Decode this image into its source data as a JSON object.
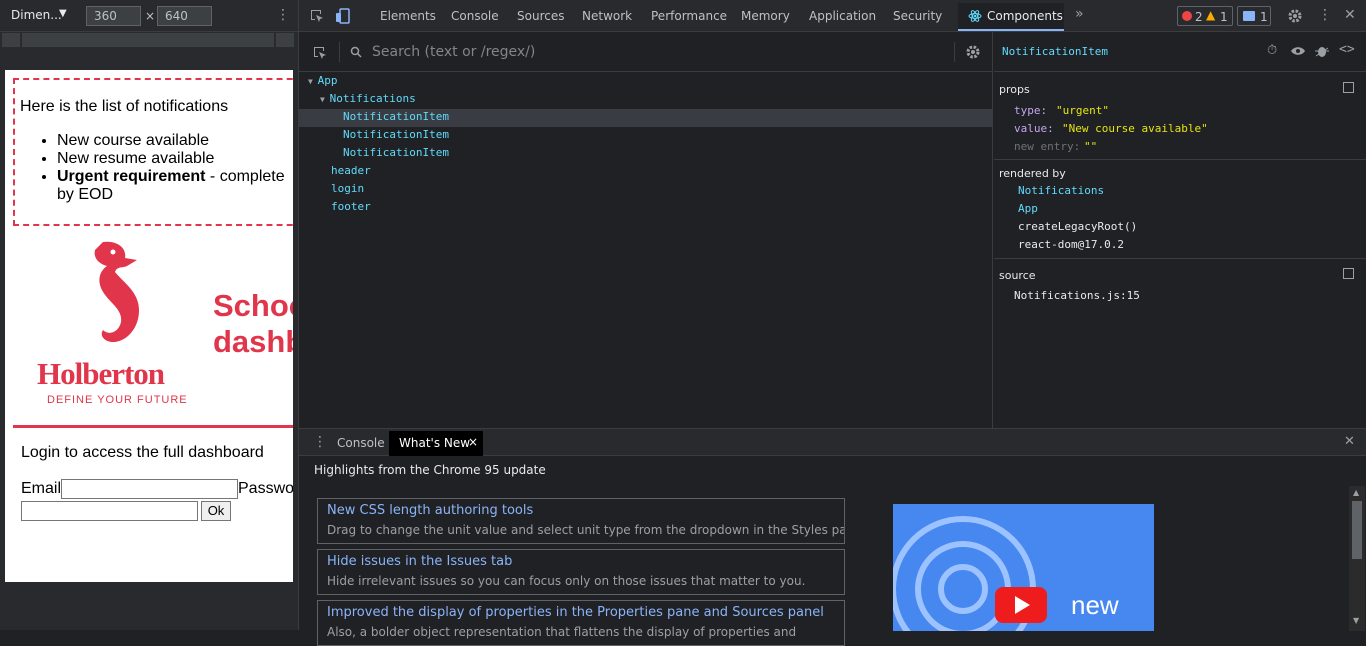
{
  "device_toolbar": {
    "device": "Dimen...",
    "width": "360",
    "separator": "×",
    "height": "640"
  },
  "page": {
    "notifications_title": "Here is the list of notifications",
    "notifications": [
      {
        "text": "New course available"
      },
      {
        "text": "New resume available"
      },
      {
        "bold": "Urgent requirement",
        "text": " - complete by EOD"
      }
    ],
    "logo_text": "Holberton",
    "logo_tagline": "DEFINE YOUR FUTURE",
    "app_title_line1": "School",
    "app_title_line2": "dashboard",
    "login_text": "Login to access the full dashboard",
    "email_label": "Email",
    "password_label": "Password",
    "ok_label": "Ok"
  },
  "devtools": {
    "tabs": [
      "Elements",
      "Console",
      "Sources",
      "Network",
      "Performance",
      "Memory",
      "Application",
      "Security"
    ],
    "active_tab": "Components",
    "errors": "2",
    "warnings": "1",
    "messages": "1",
    "search_placeholder": "Search (text or /regex/)",
    "tree": [
      {
        "label": "App",
        "depth": 0,
        "arrow": true
      },
      {
        "label": "Notifications",
        "depth": 1,
        "arrow": true
      },
      {
        "label": "NotificationItem",
        "depth": 2,
        "selected": true
      },
      {
        "label": "NotificationItem",
        "depth": 2
      },
      {
        "label": "NotificationItem",
        "depth": 2
      },
      {
        "label": "header",
        "depth": 1
      },
      {
        "label": "login",
        "depth": 1
      },
      {
        "label": "footer",
        "depth": 1
      }
    ],
    "selected_component": "NotificationItem",
    "props_title": "props",
    "props": [
      {
        "key": "type",
        "value": "\"urgent\""
      },
      {
        "key": "value",
        "value": "\"New course available\""
      },
      {
        "key": "new entry",
        "value": "\"\""
      }
    ],
    "rendered_by_title": "rendered by",
    "rendered_by": [
      "Notifications",
      "App",
      "createLegacyRoot()",
      "react-dom@17.0.2"
    ],
    "source_title": "source",
    "source": "Notifications.js:15"
  },
  "drawer": {
    "tabs": [
      "Console",
      "What's New"
    ],
    "close_tab": "×",
    "close_drawer": "✕",
    "highlights": "Highlights from the Chrome 95 update",
    "cards": [
      {
        "title": "New CSS length authoring tools",
        "desc": "Drag to change the unit value and select unit type from the dropdown in the Styles pane."
      },
      {
        "title": "Hide issues in the Issues tab",
        "desc": "Hide irrelevant issues so you can focus only on those issues that matter to you."
      },
      {
        "title": "Improved the display of properties in the Properties pane and Sources panel",
        "desc": "Also, a bolder object representation that flattens the display of properties and"
      }
    ],
    "video_text": "new"
  },
  "colors": {
    "brand_red": "#e1354b",
    "react_blue": "#61dafb",
    "link_blue": "#8ab4f8",
    "string_yellow": "#e5e510"
  }
}
